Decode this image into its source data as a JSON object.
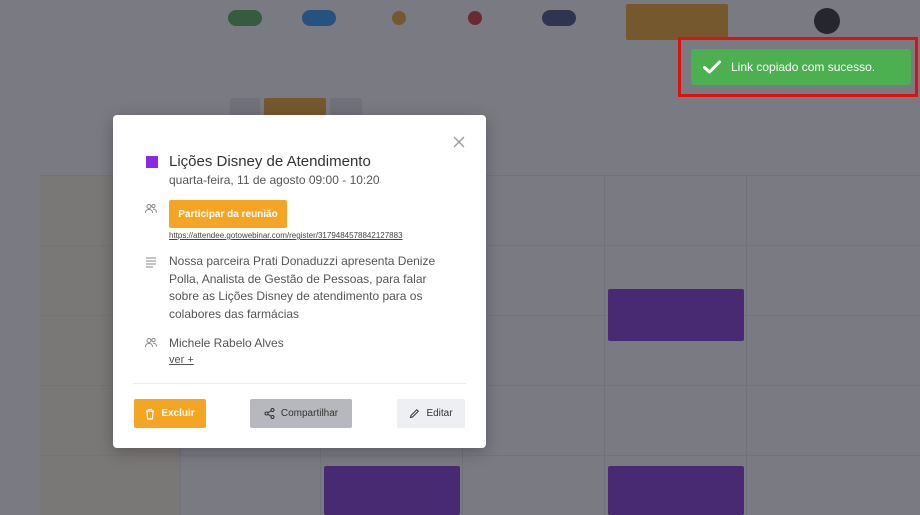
{
  "toast": {
    "message": "Link copiado com sucesso.",
    "icon": "check-icon",
    "color": "#4caf50"
  },
  "modal": {
    "title": "Lições Disney de Atendimento",
    "color": "#8a2be2",
    "datetime": "quarta-feira, 11 de agosto 09:00 - 10:20",
    "join_button": "Participar da reunião",
    "join_link": "https://attendee.gotowebinar.com/register/3179484578842127883",
    "description": "Nossa parceira Prati Donaduzzi apresenta Denize Polla, Analista de Gestão de Pessoas, para falar sobre as Lições Disney de atendimento para os colabores das farmácias",
    "organizer": "Michele Rabelo Alves",
    "see_more": "ver +",
    "buttons": {
      "delete": "Excluir",
      "share": "Compartilhar",
      "edit": "Editar"
    }
  },
  "colors": {
    "accent": "#f5a524",
    "event": "#7b2fd6",
    "overlay": "rgba(40,40,55,0.62)"
  }
}
